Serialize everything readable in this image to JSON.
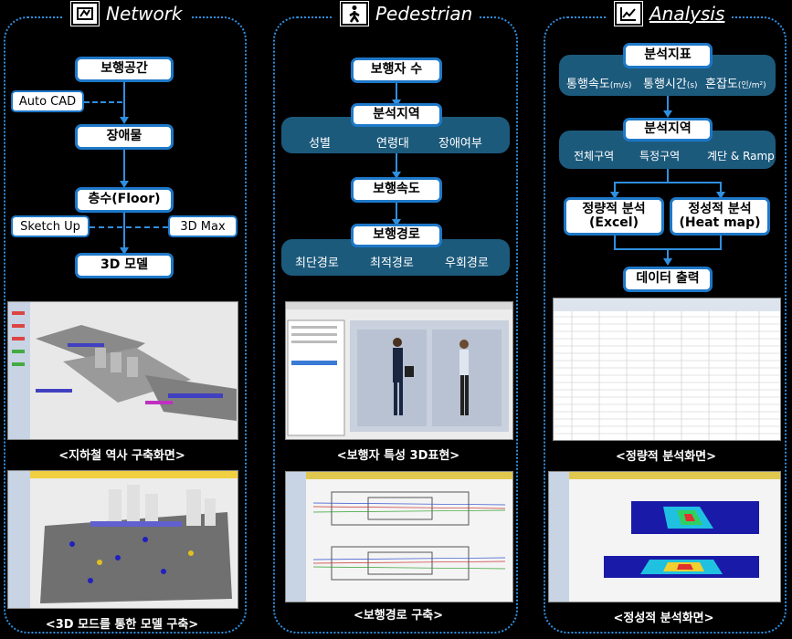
{
  "network": {
    "title": "Network",
    "boxes": {
      "space": "보행공간",
      "obstacle": "장애물",
      "floor": "층수(Floor)",
      "model": "3D 모델"
    },
    "tools": {
      "autocad": "Auto CAD",
      "sketchup": "Sketch Up",
      "max3d": "3D Max"
    },
    "captions": [
      "<지하철 역사 구축화면>",
      "<3D 모드를 통한 모델 구축>"
    ]
  },
  "pedestrian": {
    "title": "Pedestrian",
    "boxes": {
      "count": "보행자 수",
      "region": "분석지역",
      "speed": "보행속도",
      "route": "보행경로"
    },
    "region_items": [
      "성별",
      "연령대",
      "장애여부"
    ],
    "route_items": [
      "최단경로",
      "최적경로",
      "우회경로"
    ],
    "captions": [
      "<보행자 특성 3D표현>",
      "<보행경로 구축>"
    ]
  },
  "analysis": {
    "title": "Analysis",
    "boxes": {
      "indicator": "분석지표",
      "region": "분석지역",
      "quant": "정량적 분석",
      "quant_sub": "(Excel)",
      "qual": "정성적 분석",
      "qual_sub": "(Heat map)",
      "output": "데이터 출력"
    },
    "indicator_items": [
      {
        "label": "통행속도",
        "unit": "(m/s)"
      },
      {
        "label": "통행시간",
        "unit": "(s)"
      },
      {
        "label": "혼잡도",
        "unit": "(인/m²)"
      }
    ],
    "region_items": [
      "전체구역",
      "특정구역",
      "계단 & Ramp"
    ],
    "captions": [
      "<정량적 분석화면>",
      "<정성적 분석화면>"
    ]
  }
}
